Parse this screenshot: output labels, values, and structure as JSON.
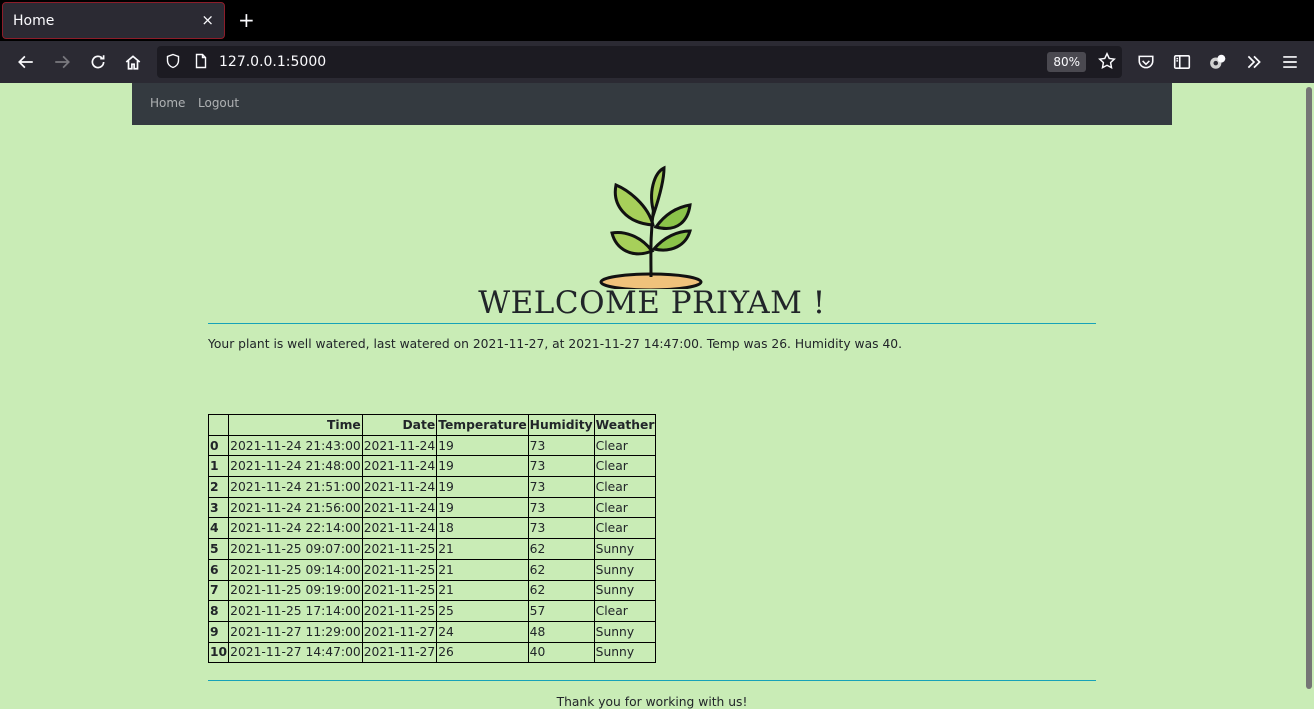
{
  "browser": {
    "tab_title": "Home",
    "tab_close": "×",
    "new_tab": "+",
    "url": "127.0.0.1:5000",
    "zoom": "80%",
    "toolbar_icons": [
      "back-icon",
      "forward-icon",
      "reload-icon",
      "home-icon",
      "shield-icon",
      "page-icon",
      "star-icon",
      "pocket-icon",
      "sidebar-icon",
      "extension-icon",
      "overflow-icon",
      "menu-icon"
    ]
  },
  "nav": {
    "home": "Home",
    "logout": "Logout"
  },
  "page": {
    "welcome": "WELCOME PRIYAM !",
    "status": "Your plant is well watered, last watered on 2021-11-27, at 2021-11-27 14:47:00. Temp was 26. Humidity was 40.",
    "footer": "Thank you for working with us!"
  },
  "table": {
    "headers": [
      "",
      "Time",
      "Date",
      "Temperature",
      "Humidity",
      "Weather"
    ],
    "rows": [
      [
        "0",
        "2021-11-24 21:43:00",
        "2021-11-24",
        "19",
        "73",
        "Clear"
      ],
      [
        "1",
        "2021-11-24 21:48:00",
        "2021-11-24",
        "19",
        "73",
        "Clear"
      ],
      [
        "2",
        "2021-11-24 21:51:00",
        "2021-11-24",
        "19",
        "73",
        "Clear"
      ],
      [
        "3",
        "2021-11-24 21:56:00",
        "2021-11-24",
        "19",
        "73",
        "Clear"
      ],
      [
        "4",
        "2021-11-24 22:14:00",
        "2021-11-24",
        "18",
        "73",
        "Clear"
      ],
      [
        "5",
        "2021-11-25 09:07:00",
        "2021-11-25",
        "21",
        "62",
        "Sunny"
      ],
      [
        "6",
        "2021-11-25 09:14:00",
        "2021-11-25",
        "21",
        "62",
        "Sunny"
      ],
      [
        "7",
        "2021-11-25 09:19:00",
        "2021-11-25",
        "21",
        "62",
        "Sunny"
      ],
      [
        "8",
        "2021-11-25 17:14:00",
        "2021-11-25",
        "25",
        "57",
        "Clear"
      ],
      [
        "9",
        "2021-11-27 11:29:00",
        "2021-11-27",
        "24",
        "48",
        "Sunny"
      ],
      [
        "10",
        "2021-11-27 14:47:00",
        "2021-11-27",
        "26",
        "40",
        "Sunny"
      ]
    ]
  },
  "colors": {
    "page_bg": "#c9ecb6",
    "navbar": "#343a40",
    "rule": "#17a2b8",
    "leaf": "#8bc34a",
    "soil": "#f0c27b"
  }
}
